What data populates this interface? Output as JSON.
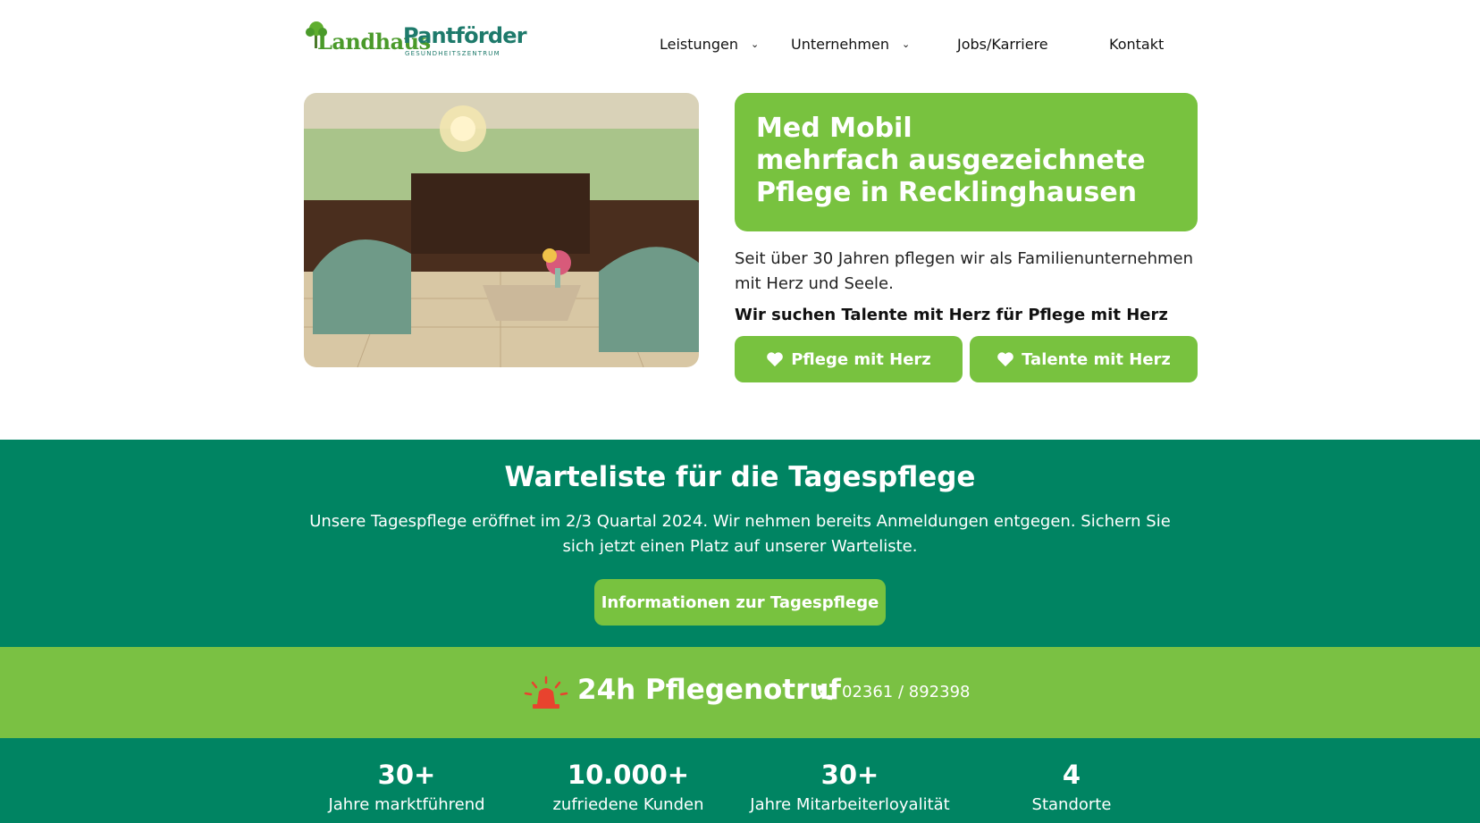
{
  "header": {
    "logo": {
      "script_text": "Landhaus",
      "brand_text": "Pantförder",
      "sub_text": "GESUNDHEITSZENTRUM"
    },
    "nav": [
      {
        "label": "Leistungen",
        "has_dropdown": true
      },
      {
        "label": "Unternehmen",
        "has_dropdown": true
      },
      {
        "label": "Jobs/Karriere",
        "has_dropdown": false
      },
      {
        "label": "Kontakt",
        "has_dropdown": false
      }
    ]
  },
  "hero": {
    "title_line1": "Med Mobil",
    "title_line2": "mehrfach ausgezeichnete",
    "title_line3": "Pflege in Recklinghausen",
    "text": "Seit über 30 Jahren pflegen wir als Familienunternehmen mit Herz und Seele.",
    "strong": "Wir suchen Talente mit Herz für Pflege mit Herz",
    "btn_pflege": "Pflege mit Herz",
    "btn_talente": "Talente mit Herz"
  },
  "waitlist": {
    "title": "Warteliste für die Tagespflege",
    "text": "Unsere Tagespflege eröffnet im 2/3 Quartal 2024. Wir nehmen bereits Anmeldungen entgegen. Sichern Sie sich jetzt einen Platz auf unserer Warteliste.",
    "button": "Informationen zur Tagespflege"
  },
  "emergency": {
    "title": "24h Pflegenotruf",
    "phone": "02361 / 892398"
  },
  "stats": [
    {
      "num": "30+",
      "label": "Jahre marktführend"
    },
    {
      "num": "10.000+",
      "label": "zufriedene Kunden"
    },
    {
      "num": "30+",
      "label": "Jahre Mitarbeiterloyalität"
    },
    {
      "num": "4",
      "label": "Standorte"
    }
  ],
  "colors": {
    "light_green": "#78c23f",
    "dark_green": "#008462",
    "banner_green": "#7ac143",
    "siren_red": "#e8432e"
  }
}
